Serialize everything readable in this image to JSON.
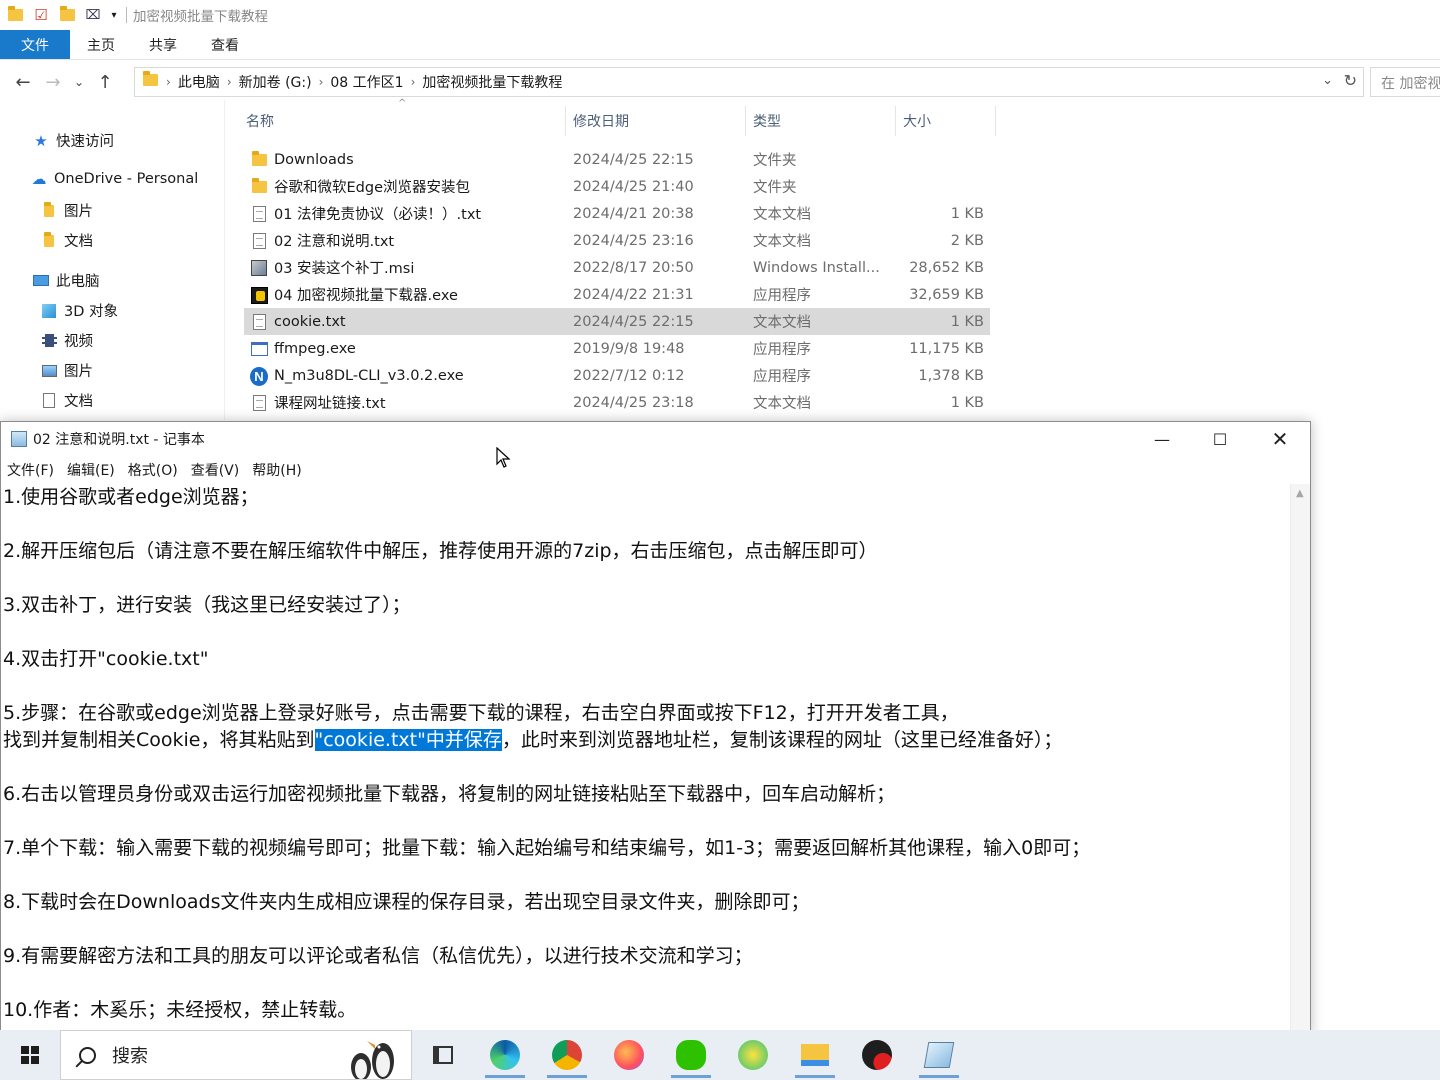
{
  "explorer": {
    "window_title": "加密视频批量下载教程",
    "ribbon_tabs": [
      "文件",
      "主页",
      "共享",
      "查看"
    ],
    "breadcrumb": [
      "此电脑",
      "新加卷 (G:)",
      "08 工作区1",
      "加密视频批量下载教程"
    ],
    "search_placeholder": "在 加密视",
    "nav": {
      "quick_access": "快速访问",
      "onedrive": "OneDrive - Personal",
      "od_pictures": "图片",
      "od_documents": "文档",
      "this_pc": "此电脑",
      "objects3d": "3D 对象",
      "videos": "视频",
      "pictures": "图片",
      "documents": "文档"
    },
    "columns": {
      "name": "名称",
      "modified": "修改日期",
      "type": "类型",
      "size": "大小"
    },
    "files": [
      {
        "name": "Downloads",
        "modified": "2024/4/25 22:15",
        "type": "文件夹",
        "size": "",
        "icon": "folder-icon"
      },
      {
        "name": "谷歌和微软Edge浏览器安装包",
        "modified": "2024/4/25 21:40",
        "type": "文件夹",
        "size": "",
        "icon": "folder-icon"
      },
      {
        "name": "01 法律免责协议（必读！）.txt",
        "modified": "2024/4/21 20:38",
        "type": "文本文档",
        "size": "1 KB",
        "icon": "text-file-icon"
      },
      {
        "name": "02 注意和说明.txt",
        "modified": "2024/4/25 23:16",
        "type": "文本文档",
        "size": "2 KB",
        "icon": "text-file-icon"
      },
      {
        "name": "03 安装这个补丁.msi",
        "modified": "2022/8/17 20:50",
        "type": "Windows Install...",
        "size": "28,652 KB",
        "icon": "installer-icon"
      },
      {
        "name": "04 加密视频批量下载器.exe",
        "modified": "2024/4/22 21:31",
        "type": "应用程序",
        "size": "32,659 KB",
        "icon": "app-icon"
      },
      {
        "name": "cookie.txt",
        "modified": "2024/4/25 22:15",
        "type": "文本文档",
        "size": "1 KB",
        "icon": "text-file-icon"
      },
      {
        "name": "ffmpeg.exe",
        "modified": "2019/9/8 19:48",
        "type": "应用程序",
        "size": "11,175 KB",
        "icon": "exe-window-icon"
      },
      {
        "name": "N_m3u8DL-CLI_v3.0.2.exe",
        "modified": "2022/7/12 0:12",
        "type": "应用程序",
        "size": "1,378 KB",
        "icon": "n-logo-icon"
      },
      {
        "name": "课程网址链接.txt",
        "modified": "2024/4/25 23:18",
        "type": "文本文档",
        "size": "1 KB",
        "icon": "text-file-icon"
      }
    ],
    "selected_file": "cookie.txt"
  },
  "notepad": {
    "title": "02 注意和说明.txt - 记事本",
    "menu": [
      "文件(F)",
      "编辑(E)",
      "格式(O)",
      "查看(V)",
      "帮助(H)"
    ],
    "lines": {
      "l1": "1.使用谷歌或者edge浏览器；",
      "l2": "2.解开压缩包后（请注意不要在解压缩软件中解压，推荐使用开源的7zip，右击压缩包，点击解压即可）",
      "l3": "3.双击补丁，进行安装（我这里已经安装过了）；",
      "l4": "4.双击打开\"cookie.txt\"",
      "l5a": "5.步骤：在谷歌或edge浏览器上登录好账号，点击需要下载的课程，右击空白界面或按下F12，打开开发者工具，",
      "l5b_pre": "找到并复制相关Cookie，将其粘贴到",
      "l5b_sel": "\"cookie.txt\"中并保存",
      "l5b_post": "，此时来到浏览器地址栏，复制该课程的网址（这里已经准备好）；",
      "l6": "6.右击以管理员身份或双击运行加密视频批量下载器，将复制的网址链接粘贴至下载器中，回车启动解析；",
      "l7": "7.单个下载：输入需要下载的视频编号即可；批量下载：输入起始编号和结束编号，如1-3；需要返回解析其他课程，输入0即可；",
      "l8": "8.下载时会在Downloads文件夹内生成相应课程的保存目录，若出现空目录文件夹，删除即可；",
      "l9": "9.有需要解密方法和工具的朋友可以评论或者私信（私信优先），以进行技术交流和学习；",
      "l10": "10.作者：木奚乐；未经授权，禁止转载。"
    }
  },
  "taskbar": {
    "search_label": "搜索",
    "apps": [
      "task-view-icon",
      "edge-icon",
      "chrome-icon",
      "firefox-icon",
      "wechat-icon",
      "music-icon",
      "file-explorer-icon",
      "record-app-icon",
      "notepad-icon"
    ]
  },
  "colors": {
    "accent": "#1979ca",
    "selection": "#0078d7",
    "row_selected": "#d9d9d9"
  }
}
